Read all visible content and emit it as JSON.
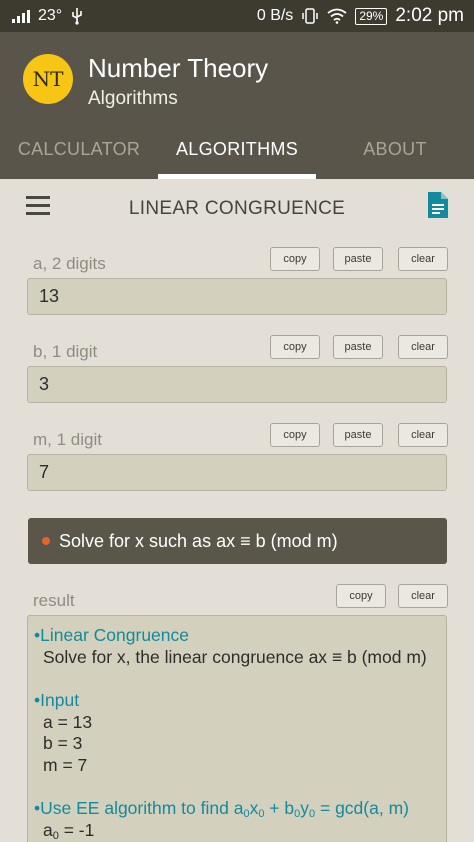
{
  "status_bar": {
    "temperature": "23°",
    "network_speed": "0 B/s",
    "battery": "29%",
    "time": "2:02 pm",
    "icons": [
      "signal-icon",
      "usb-icon",
      "vibrate-icon",
      "wifi-icon",
      "battery-icon"
    ]
  },
  "app": {
    "logo_text": "NT",
    "title": "Number Theory",
    "subtitle": "Algorithms",
    "logo_color": "#f7c514",
    "header_color": "#59554a"
  },
  "tabs": [
    {
      "label": "CALCULATOR",
      "active": false
    },
    {
      "label": "ALGORITHMS",
      "active": true
    },
    {
      "label": "ABOUT",
      "active": false
    }
  ],
  "toolbar": {
    "title": "LINEAR CONGRUENCE",
    "menu_icon": "hamburger-menu-icon",
    "doc_icon": "document-icon",
    "doc_icon_color": "#138a9d"
  },
  "fields": [
    {
      "label": "a, 2 digits",
      "value": "13",
      "copy_label": "copy",
      "paste_label": "paste",
      "clear_label": "clear"
    },
    {
      "label": "b, 1 digit",
      "value": "3",
      "copy_label": "copy",
      "paste_label": "paste",
      "clear_label": "clear"
    },
    {
      "label": "m, 1 digit",
      "value": "7",
      "copy_label": "copy",
      "paste_label": "paste",
      "clear_label": "clear"
    }
  ],
  "solve_button": {
    "label": "Solve for x such as ax ≡ b (mod m)",
    "dot_color": "#e8622c"
  },
  "result": {
    "label": "result",
    "copy_label": "copy",
    "clear_label": "clear",
    "heading_color": "#138a9d",
    "lines": {
      "h1": "Linear Congruence",
      "t1": "Solve for x, the linear congruence ax ≡ b (mod m)",
      "h2": "Input",
      "t2": "a = 13",
      "t3": "b = 3",
      "t4": "m = 7",
      "h3_prefix": "Use EE algorithm to find a",
      "h3_sub1": "0",
      "h3_mid1": "x",
      "h3_sub2": "0",
      "h3_mid2": " + b",
      "h3_sub3": "0",
      "h3_mid3": "y",
      "h3_sub4": "0",
      "h3_suffix": " = gcd(a, m)",
      "t5_prefix": "a",
      "t5_sub": "0",
      "t5_suffix": " = -1"
    }
  }
}
